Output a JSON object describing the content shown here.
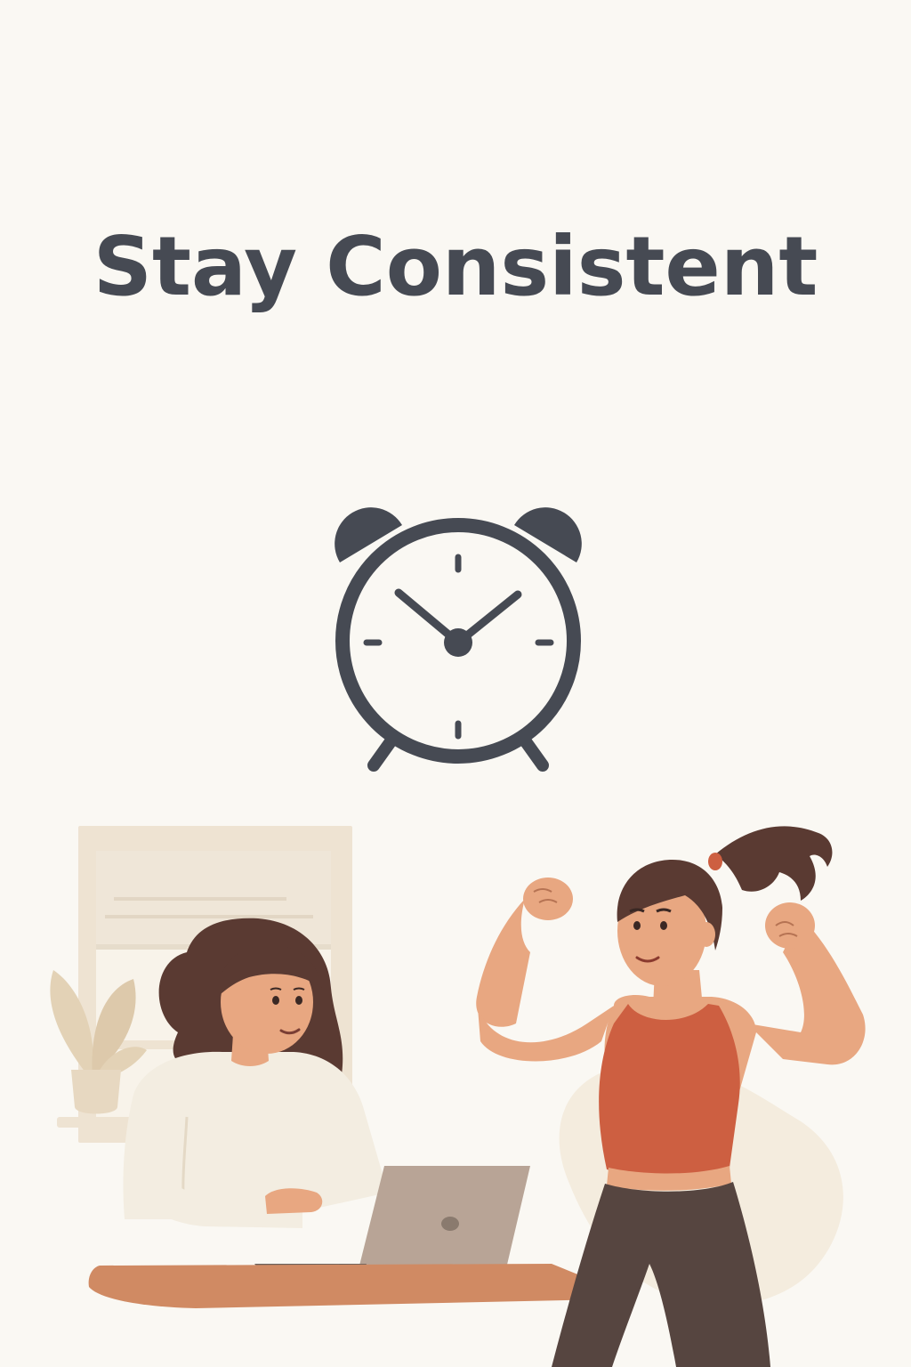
{
  "title": "Stay Consistent",
  "icons": {
    "clock": "alarm-clock-icon"
  },
  "colors": {
    "background": "#faf8f3",
    "title_text": "#464a53",
    "clock": "#464a53",
    "accent_top": "#cd5f41",
    "skin": "#e8a781",
    "hair": "#5a3a32",
    "leggings": "#564540",
    "sweater": "#f3ede1",
    "desk": "#d08a63",
    "laptop": "#b8a496",
    "window": "#eee3d2",
    "plant": "#e0ceb2"
  }
}
